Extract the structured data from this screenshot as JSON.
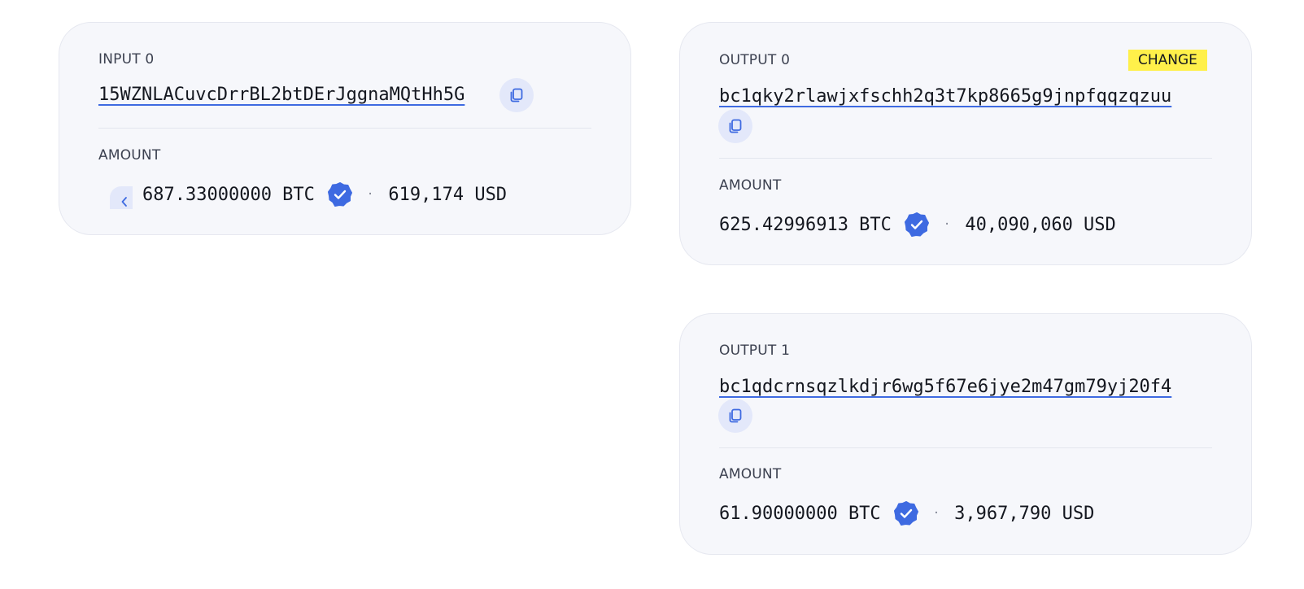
{
  "colors": {
    "accent": "#3e6ae1",
    "card_bg": "#f6f7fb",
    "change_badge": "#fff04a",
    "copy_bg": "#e3e8fa"
  },
  "inputs": [
    {
      "label": "INPUT 0",
      "address": "15WZNLACuvcDrrBL2btDErJggnaMQtHh5G",
      "amount_label": "AMOUNT",
      "btc": "687.33000000 BTC",
      "usd": "619,174 USD",
      "icons": [
        "copy-icon",
        "verified-badge-icon",
        "chevron-left-icon"
      ]
    }
  ],
  "outputs": [
    {
      "label": "OUTPUT 0",
      "badge": "CHANGE",
      "address": "bc1qky2rlawjxfschh2q3t7kp8665g9jnpfqqzqzuu",
      "amount_label": "AMOUNT",
      "btc": "625.42996913 BTC",
      "usd": "40,090,060 USD",
      "icons": [
        "copy-icon",
        "verified-badge-icon"
      ]
    },
    {
      "label": "OUTPUT 1",
      "address": "bc1qdcrnsqzlkdjr6wg5f67e6jye2m47gm79yj20f4",
      "amount_label": "AMOUNT",
      "btc": "61.90000000 BTC",
      "usd": "3,967,790 USD",
      "icons": [
        "copy-icon",
        "verified-badge-icon"
      ]
    }
  ],
  "separator": "·"
}
